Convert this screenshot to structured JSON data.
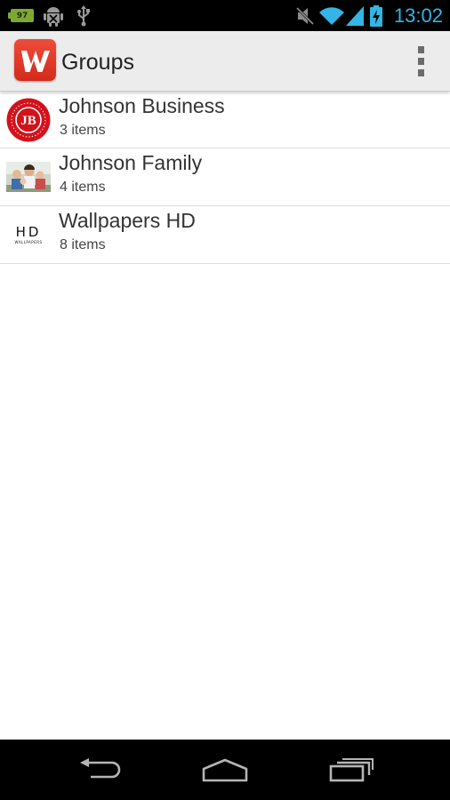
{
  "status_bar": {
    "battery_level": "97",
    "time": "13:02",
    "icons": [
      "battery-icon",
      "android-debug-icon",
      "usb-icon",
      "mute-icon",
      "wifi-icon",
      "signal-icon",
      "charging-battery-icon"
    ],
    "accent_color": "#33b5e5"
  },
  "action_bar": {
    "logo_icon": "w-logo-icon",
    "logo_letter": "W",
    "title": "Groups",
    "menu_icon": "overflow-menu-icon",
    "brand_color": "#e03c2c"
  },
  "groups": [
    {
      "title": "Johnson Business",
      "subtitle": "3 items",
      "thumbnail": "jb-badge",
      "badge_text": "JB"
    },
    {
      "title": "Johnson Family",
      "subtitle": "4 items",
      "thumbnail": "family-photo"
    },
    {
      "title": "Wallpapers HD",
      "subtitle": "8 items",
      "thumbnail": "hd-wallpapers-logo",
      "logo_text": "HD",
      "logo_subtext": "WALLPAPERS"
    }
  ],
  "nav_bar": {
    "icons": [
      "back-icon",
      "home-icon",
      "recents-icon"
    ]
  }
}
